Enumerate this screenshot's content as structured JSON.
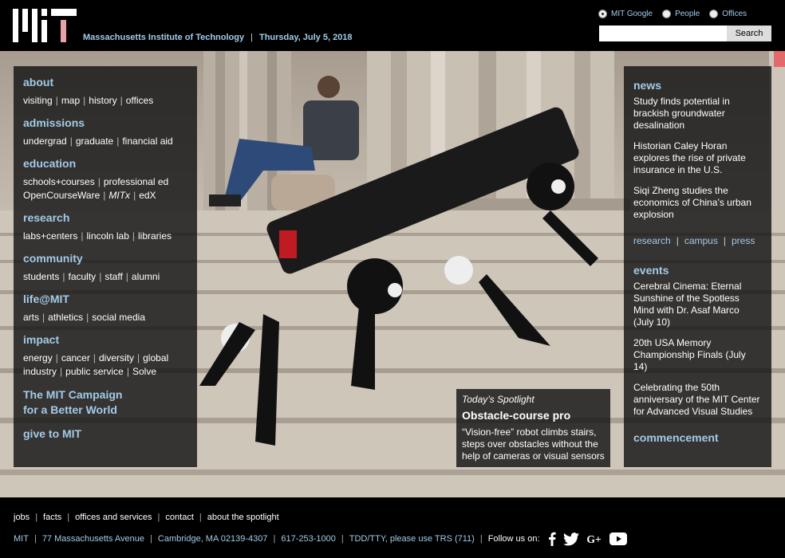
{
  "header": {
    "logo_text": "MIT",
    "institute_name": "Massachusetts Institute of Technology",
    "date": "Thursday, July 5, 2018",
    "search_options": [
      {
        "label": "MIT Google",
        "selected": true
      },
      {
        "label": "People",
        "selected": false
      },
      {
        "label": "Offices",
        "selected": false
      }
    ],
    "search_value": "",
    "search_button": "Search"
  },
  "nav": {
    "about": {
      "heading": "about",
      "links": [
        "visiting",
        "map",
        "history",
        "offices"
      ]
    },
    "admissions": {
      "heading": "admissions",
      "links": [
        "undergrad",
        "graduate",
        "financial aid"
      ]
    },
    "education": {
      "heading": "education",
      "links_row1": [
        "schools+courses",
        "professional ed"
      ],
      "links_row2": [
        "OpenCourseWare",
        "MITx",
        "edX"
      ]
    },
    "research": {
      "heading": "research",
      "links": [
        "labs+centers",
        "lincoln lab",
        "libraries"
      ]
    },
    "community": {
      "heading": "community",
      "links": [
        "students",
        "faculty",
        "staff",
        "alumni"
      ]
    },
    "life": {
      "heading": "life@MIT",
      "links": [
        "arts",
        "athletics",
        "social media"
      ]
    },
    "impact": {
      "heading": "impact",
      "links_row1": [
        "energy",
        "cancer",
        "diversity",
        "global"
      ],
      "links_row2": [
        "industry",
        "public service",
        "Solve"
      ]
    },
    "campaign_line1": "The MIT Campaign",
    "campaign_line2": "for a Better World",
    "give": "give to MIT"
  },
  "news": {
    "heading": "news",
    "stories": [
      "Study finds potential in brackish groundwater desalination",
      "Historian Caley Horan explores the rise of private insurance in the U.S.",
      "Siqi Zheng studies the economics of China’s urban explosion"
    ],
    "links": [
      "research",
      "campus",
      "press"
    ]
  },
  "events": {
    "heading": "events",
    "items": [
      "Cerebral Cinema: Eternal Sunshine of the Spotless Mind with Dr. Asaf Marco (July 10)",
      "20th USA Memory Championship Finals (July 14)",
      "Celebrating the 50th anniversary of the MIT Center for Advanced Visual Studies"
    ]
  },
  "commencement": "commencement",
  "spotlight": {
    "label": "Today’s Spotlight",
    "title": "Obstacle-course pro",
    "description": "“Vision-free” robot climbs stairs, steps over obstacles without the help of cameras or visual sensors"
  },
  "footer": {
    "links": [
      "jobs",
      "facts",
      "offices and services",
      "contact",
      "about the spotlight"
    ],
    "info": [
      "MIT",
      "77 Massachusetts Avenue",
      "Cambridge, MA 02139-4307",
      "617-253-1000",
      "TDD/TTY, please use TRS (711)"
    ],
    "follow_label": "Follow us on:",
    "social_icons": [
      "facebook-icon",
      "twitter-icon",
      "google-plus-icon",
      "youtube-icon"
    ]
  }
}
